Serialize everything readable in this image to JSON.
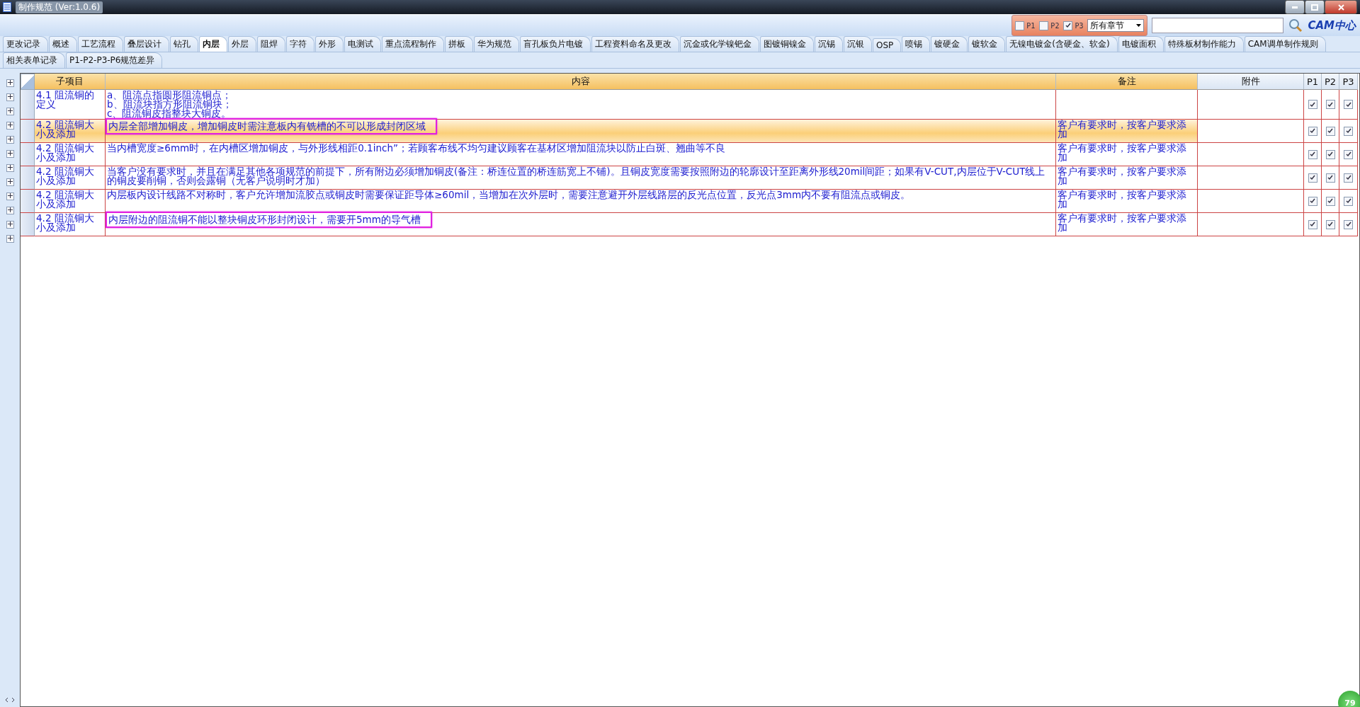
{
  "window": {
    "title": "制作规范 (Ver:1.0.6)"
  },
  "filters": [
    {
      "label": "P1",
      "checked": false
    },
    {
      "label": "P2",
      "checked": false
    },
    {
      "label": "P3",
      "checked": true
    }
  ],
  "chapter_select": {
    "value": "所有章节"
  },
  "logo": {
    "text": "CAM中心"
  },
  "tab_rows": [
    [
      {
        "label": "更改记录",
        "selected": false
      },
      {
        "label": "概述",
        "selected": false
      },
      {
        "label": "工艺流程",
        "selected": false
      },
      {
        "label": "叠层设计",
        "selected": false
      },
      {
        "label": "钻孔",
        "selected": false
      },
      {
        "label": "内层",
        "selected": true
      },
      {
        "label": "外层",
        "selected": false
      },
      {
        "label": "阻焊",
        "selected": false
      },
      {
        "label": "字符",
        "selected": false
      },
      {
        "label": "外形",
        "selected": false
      },
      {
        "label": "电测试",
        "selected": false
      },
      {
        "label": "重点流程制作",
        "selected": false
      },
      {
        "label": "拼板",
        "selected": false
      },
      {
        "label": "华为规范",
        "selected": false
      },
      {
        "label": "盲孔板负片电镀",
        "selected": false
      },
      {
        "label": "工程资料命名及更改",
        "selected": false
      },
      {
        "label": "沉金或化学镍钯金",
        "selected": false
      },
      {
        "label": "图镀铜镍金",
        "selected": false
      },
      {
        "label": "沉锡",
        "selected": false
      },
      {
        "label": "沉银",
        "selected": false
      },
      {
        "label": "OSP",
        "selected": false
      },
      {
        "label": "喷锡",
        "selected": false
      },
      {
        "label": "镀硬金",
        "selected": false
      },
      {
        "label": "镀软金",
        "selected": false
      },
      {
        "label": "无镍电镀金(含硬金、软金)",
        "selected": false
      },
      {
        "label": "电镀面积",
        "selected": false
      },
      {
        "label": "特殊板材制作能力",
        "selected": false
      },
      {
        "label": "CAM调单制作规则",
        "selected": false
      }
    ],
    [
      {
        "label": "相关表单记录",
        "selected": false
      },
      {
        "label": "P1-P2-P3-P6规范差异",
        "selected": false
      }
    ]
  ],
  "table": {
    "columns": [
      "子项目",
      "内容",
      "备注",
      "附件",
      "P1",
      "P2",
      "P3"
    ],
    "rows": [
      {
        "item": "4.1 阻流铜的定义",
        "content": [
          "a、阻流点指圆形阻流铜点；",
          "b、阻流块指方形阻流铜块；",
          "c、阻流铜皮指整块大铜皮。"
        ],
        "note": "",
        "attachment": "",
        "selected": false,
        "highlighted": false,
        "p1": true,
        "p2": true,
        "p3": true
      },
      {
        "item": "4.2 阻流铜大小及添加",
        "content": [
          "内层全部增加铜皮，增加铜皮时需注意板内有铣槽的不可以形成封闭区域"
        ],
        "note": "客户有要求时，按客户要求添加",
        "attachment": "",
        "selected": true,
        "highlighted": true,
        "p1": true,
        "p2": true,
        "p3": true
      },
      {
        "item": "4.2 阻流铜大小及添加",
        "content": [
          "当内槽宽度≥6mm时，在内槽区增加铜皮，与外形线相距0.1inch”；若顾客布线不均匀建议顾客在基材区增加阻流块以防止白斑、翘曲等不良"
        ],
        "note": "客户有要求时，按客户要求添加",
        "attachment": "",
        "selected": false,
        "highlighted": false,
        "p1": true,
        "p2": true,
        "p3": true
      },
      {
        "item": "4.2 阻流铜大小及添加",
        "content": [
          "当客户没有要求时，并且在满足其他各项规范的前提下，所有附边必须增加铜皮(备注：桥连位置的桥连筋宽上不铺)。且铜皮宽度需要按照附边的轮廓设计至距离外形线20mil间距；如果有V-CUT,内层位于V-CUT线上的铜皮要削铜，否则会露铜（无客户说明时才加）"
        ],
        "note": "客户有要求时，按客户要求添加",
        "attachment": "",
        "selected": false,
        "highlighted": false,
        "p1": true,
        "p2": true,
        "p3": true
      },
      {
        "item": "4.2 阻流铜大小及添加",
        "content": [
          "内层板内设计线路不对称时，客户允许增加流胶点或铜皮时需要保证距导体≥60mil，当增加在次外层时，需要注意避开外层线路层的反光点位置，反光点3mm内不要有阻流点或铜皮。"
        ],
        "note": "客户有要求时，按客户要求添加",
        "attachment": "",
        "selected": false,
        "highlighted": false,
        "p1": true,
        "p2": true,
        "p3": true
      },
      {
        "item": "4.2 阻流铜大小及添加",
        "content": [
          "内层附边的阻流铜不能以整块铜皮环形封闭设计，需要开5mm的导气槽"
        ],
        "note": "客户有要求时，按客户要求添加",
        "attachment": "",
        "selected": false,
        "highlighted": true,
        "p1": true,
        "p2": true,
        "p3": true
      }
    ]
  },
  "badge": {
    "text": "79"
  }
}
